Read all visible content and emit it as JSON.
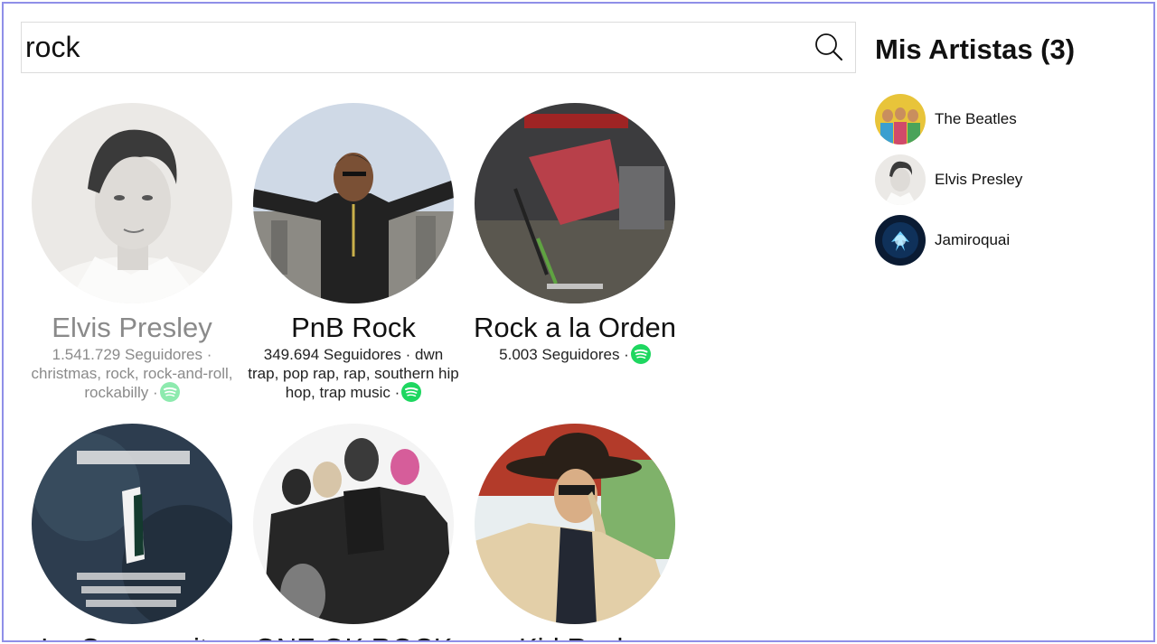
{
  "search": {
    "value": "rock"
  },
  "results": [
    {
      "name": "Elvis Presley",
      "meta": "1.541.729 Seguidores · christmas, rock, rock-and-roll, rockabilly ·",
      "dim": true,
      "avatar": "elvis-presley-photo"
    },
    {
      "name": "PnB Rock",
      "meta": "349.694 Seguidores · dwn trap, pop rap, rap, southern hip hop, trap music ·",
      "dim": false,
      "avatar": "pnb-rock-photo"
    },
    {
      "name": "Rock a la Orden",
      "meta": "5.003 Seguidores ·",
      "dim": false,
      "avatar": "rock-a-la-orden-album-art"
    },
    {
      "name": "La Cumparsita",
      "meta": "",
      "dim": false,
      "avatar": "la-cumparsita-rock-album-art"
    },
    {
      "name": "ONE OK ROCK",
      "meta": "",
      "dim": false,
      "avatar": "one-ok-rock-photo"
    },
    {
      "name": "Kid Rock",
      "meta": "",
      "dim": false,
      "avatar": "kid-rock-photo"
    }
  ],
  "sidebar": {
    "title": "Mis Artistas (3)",
    "artists": [
      {
        "label": "The Beatles",
        "avatar": "the-beatles-photo"
      },
      {
        "label": "Elvis Presley",
        "avatar": "elvis-presley-photo"
      },
      {
        "label": "Jamiroquai",
        "avatar": "jamiroquai-photo"
      }
    ]
  },
  "icons": {
    "search": "search-icon",
    "spotify": "spotify-icon"
  },
  "colors": {
    "spotify_green": "#1ed760",
    "frame_border": "#8f8fe8",
    "muted_text": "#8a8a8a"
  }
}
